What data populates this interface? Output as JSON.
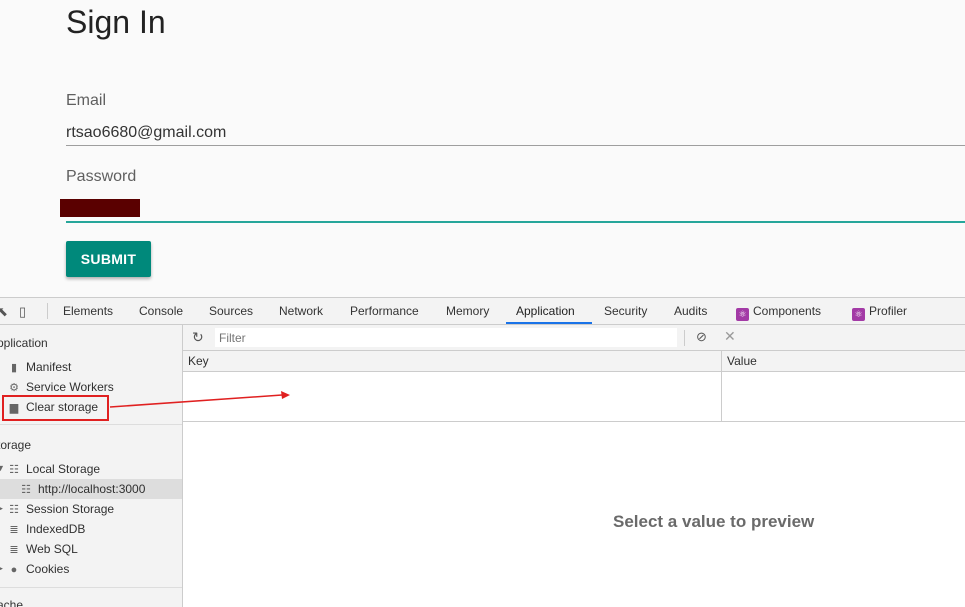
{
  "page": {
    "title": "Sign In",
    "email_label": "Email",
    "email_value": "rtsao6680@gmail.com",
    "password_label": "Password",
    "submit_label": "SUBMIT"
  },
  "devtools": {
    "tabs": [
      "Elements",
      "Console",
      "Sources",
      "Network",
      "Performance",
      "Memory",
      "Application",
      "Security",
      "Audits",
      "Components",
      "Profiler"
    ],
    "active_tab": "Application",
    "sidebar": {
      "application_header": "pplication",
      "application_items": [
        {
          "label": "Manifest",
          "icon": "file-icon"
        },
        {
          "label": "Service Workers",
          "icon": "gear-icon"
        },
        {
          "label": "Clear storage",
          "icon": "trash-icon"
        }
      ],
      "storage_header": "torage",
      "local_storage": "Local Storage",
      "local_storage_origin": "http://localhost:3000",
      "session_storage": "Session Storage",
      "indexeddb": "IndexedDB",
      "websql": "Web SQL",
      "cookies": "Cookies",
      "cache_header": "ache"
    },
    "filter_placeholder": "Filter",
    "columns": {
      "key": "Key",
      "value": "Value"
    },
    "preview_text": "Select a value to preview"
  },
  "colors": {
    "submit": "#00897b",
    "active_underline": "#26a69a",
    "annotation": "#e02020",
    "tab_highlight": "#1a73e8"
  }
}
